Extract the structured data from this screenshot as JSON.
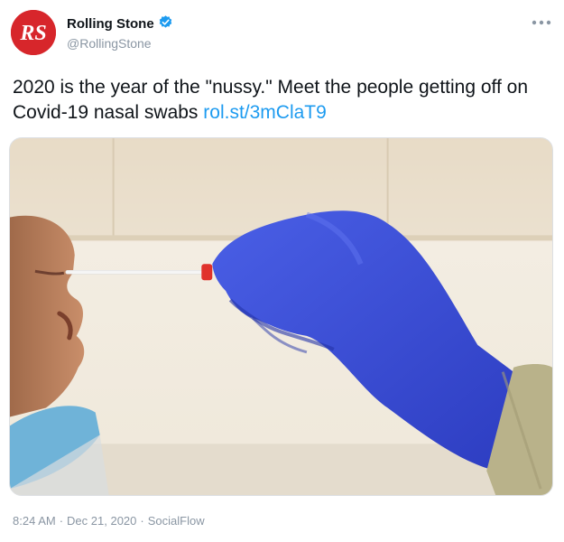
{
  "account": {
    "display_name": "Rolling Stone",
    "handle": "@RollingStone",
    "avatar_text": "RS",
    "verified": true
  },
  "tweet": {
    "text_part1": "2020 is the year of the \"nussy.\" Meet the people getting off on Covid-19 nasal swabs ",
    "link_text": "rol.st/3mClaT9",
    "time": "8:24 AM",
    "separator": "·",
    "date": "Dec 21, 2020",
    "source": "SocialFlow"
  },
  "icons": {
    "more": "more-horizontal-icon",
    "verified": "verified-badge-icon"
  },
  "colors": {
    "brand_red": "#d7262b",
    "link_blue": "#1d9bf0",
    "verified_blue": "#1d9bf0",
    "muted_gray": "#8a96a3",
    "glove_blue": "#3b4fd8"
  }
}
